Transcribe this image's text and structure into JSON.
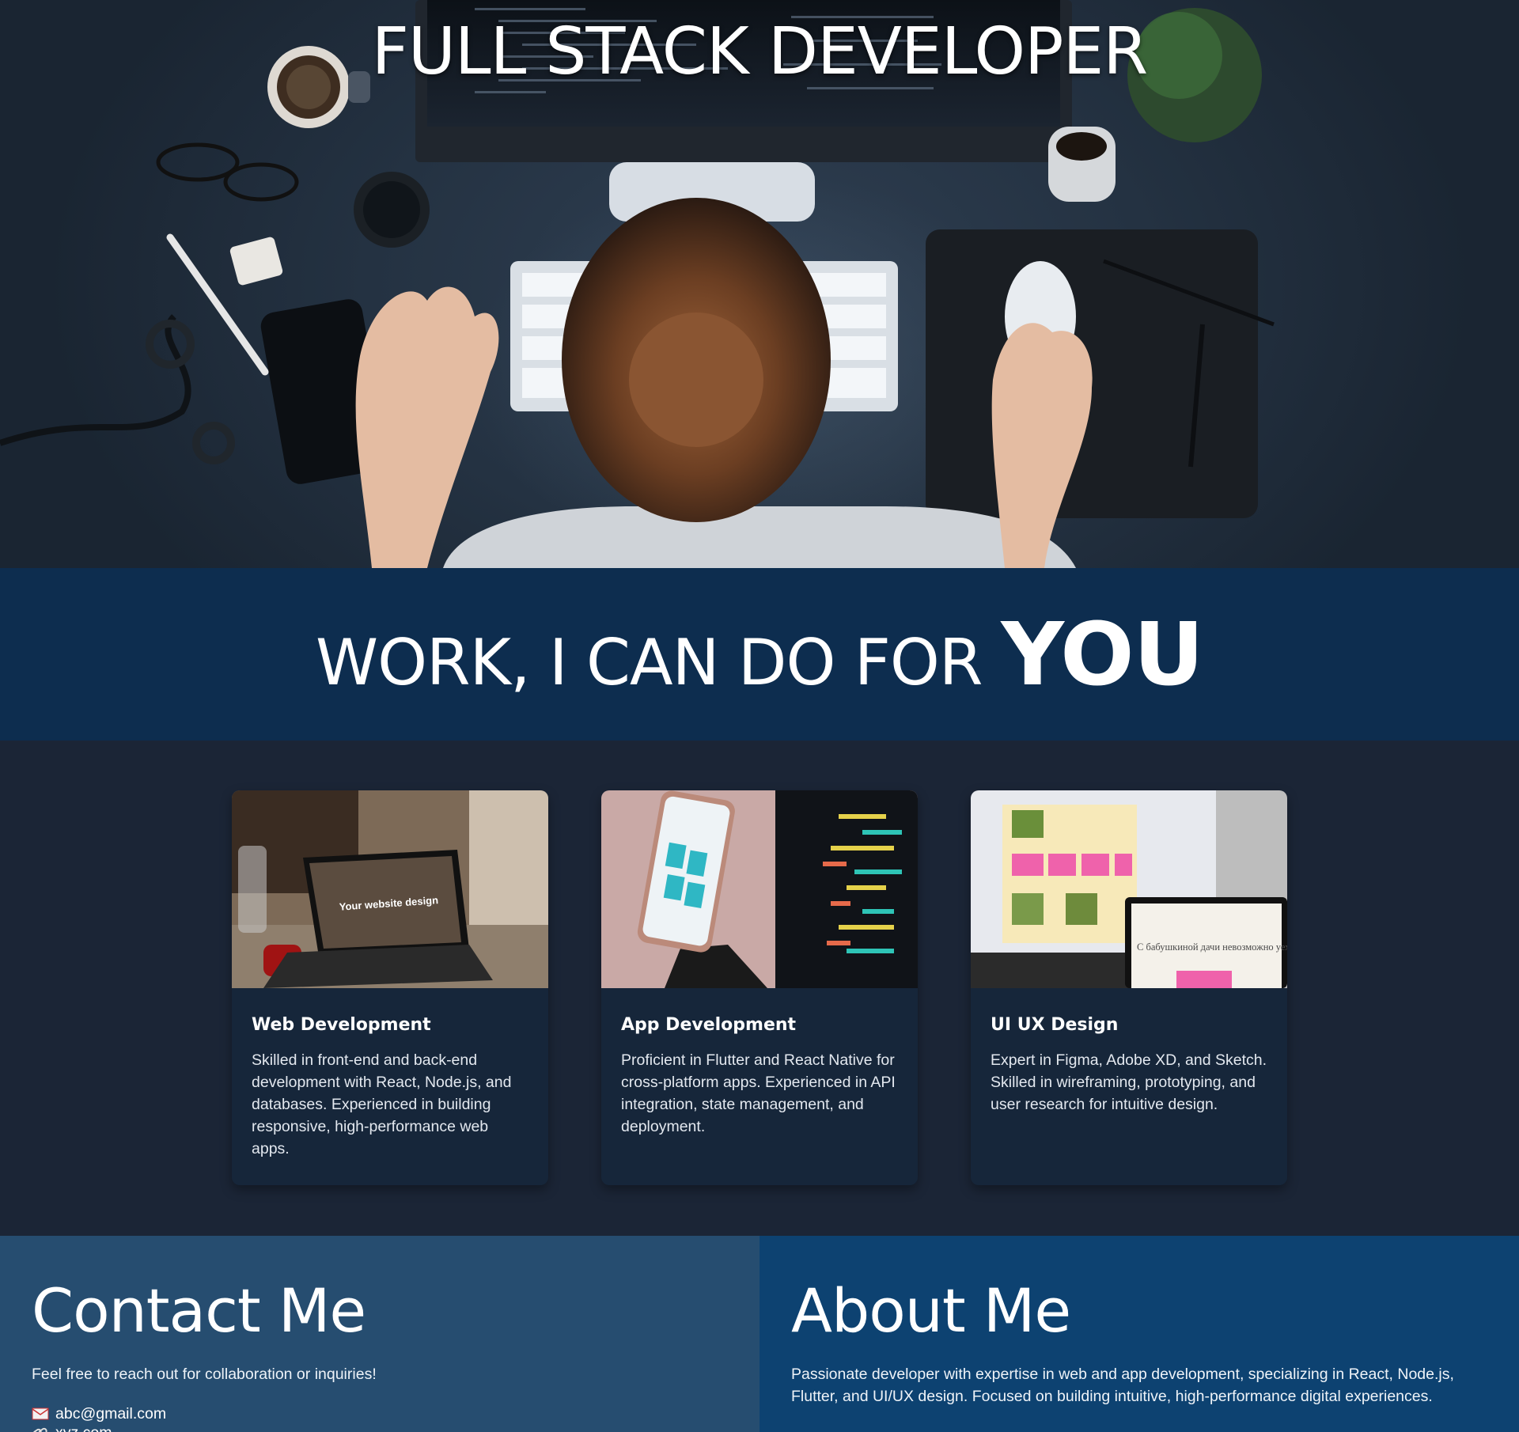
{
  "hero": {
    "title": "FULL STACK DEVELOPER"
  },
  "work": {
    "heading_main": "WORK, I CAN DO FOR",
    "heading_emphasis": "YOU"
  },
  "services": [
    {
      "title": "Web Development",
      "text": "Skilled in front-end and back-end development with React, Node.js, and databases. Experienced in building responsive, high-performance web apps.",
      "image_caption": "Your website design"
    },
    {
      "title": "App Development",
      "text": "Proficient in Flutter and React Native for cross-platform apps. Experienced in API integration, state management, and deployment."
    },
    {
      "title": "UI UX Design",
      "text": "Expert in Figma, Adobe XD, and Sketch. Skilled in wireframing, prototyping, and user research for intuitive design.",
      "image_caption": "С бабушкиной дачи невозможно уехать с пустыми руками"
    }
  ],
  "contact": {
    "heading": "Contact Me",
    "text": "Feel free to reach out for collaboration or inquiries!",
    "items": [
      {
        "icon": "mail-icon",
        "value": "abc@gmail.com"
      },
      {
        "icon": "link-icon",
        "value": "xyz.com"
      }
    ]
  },
  "about": {
    "heading": "About Me",
    "text": "Passionate developer with expertise in web and app development, specializing in React, Node.js, Flutter, and UI/UX design. Focused on building intuitive, high-performance digital experiences."
  }
}
